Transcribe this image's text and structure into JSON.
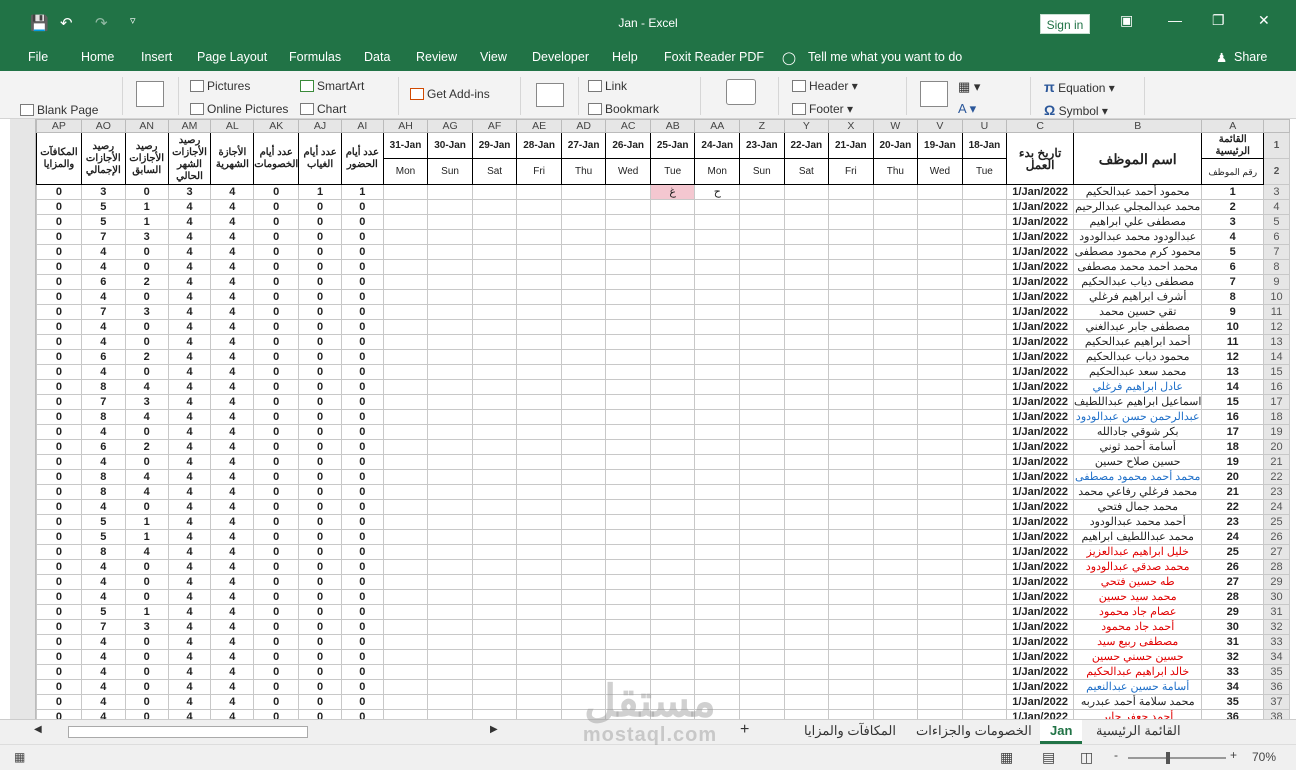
{
  "window": {
    "title": "Jan  -  Excel",
    "sign_in": "Sign in",
    "share": "Share"
  },
  "menu": [
    "File",
    "Home",
    "Insert",
    "Page Layout",
    "Formulas",
    "Data",
    "Review",
    "View",
    "Developer",
    "Help",
    "Foxit Reader PDF",
    "Tell me what you want to do"
  ],
  "ribbon": {
    "blank_page": "Blank Page",
    "pictures": "Pictures",
    "online_pictures": "Online Pictures",
    "smartart": "SmartArt",
    "chart": "Chart",
    "get_addins": "Get Add-ins",
    "link": "Link",
    "bookmark": "Bookmark",
    "header": "Header",
    "footer": "Footer",
    "equation": "Equation",
    "symbol": "Symbol"
  },
  "columns": [
    "AP",
    "AO",
    "AN",
    "AM",
    "AL",
    "AK",
    "AJ",
    "AI",
    "AH",
    "AG",
    "AF",
    "AE",
    "AD",
    "AC",
    "AB",
    "AA",
    "Z",
    "Y",
    "X",
    "W",
    "V",
    "U",
    "C",
    "B",
    "A"
  ],
  "headers": {
    "bonus": "المكافآت والمزايا",
    "total_leave_balance": "رصيد الأجازات الإجمالي",
    "prev_leave_balance": "رصيد الأجازات السابق",
    "monthly_leave_balance": "رصيد الأجازات الشهر الحالي",
    "monthly_leave": "الأجازة الشهرية",
    "deduction_days": "عدد أيام الخصومات",
    "absence_days": "عدد أيام الغياب",
    "attendance_days": "عدد أيام الحضور",
    "start_date": "تاريخ بدء العمل",
    "emp_name": "اسم الموظف",
    "main_list": "القائمة الرئيسية",
    "emp_no": "رقم الموظف"
  },
  "dates": [
    "31-Jan",
    "30-Jan",
    "29-Jan",
    "28-Jan",
    "27-Jan",
    "26-Jan",
    "25-Jan",
    "24-Jan",
    "23-Jan",
    "22-Jan",
    "21-Jan",
    "20-Jan",
    "19-Jan",
    "18-Jan"
  ],
  "days": [
    "Mon",
    "Sun",
    "Sat",
    "Fri",
    "Thu",
    "Wed",
    "Tue",
    "Mon",
    "Sun",
    "Sat",
    "Fri",
    "Thu",
    "Wed",
    "Tue"
  ],
  "marks": {
    "r1_25": "غ",
    "r1_24": "ح"
  },
  "rows": [
    {
      "n": "1",
      "name": "محمود أحمد عبدالحكيم",
      "c": "",
      "d": "1/Jan/2022",
      "v": [
        "0",
        "3",
        "0",
        "3",
        "4",
        "0",
        "1",
        "1"
      ]
    },
    {
      "n": "2",
      "name": "محمد عبدالمجلي عبدالرحيم",
      "c": "",
      "d": "1/Jan/2022",
      "v": [
        "0",
        "5",
        "1",
        "4",
        "4",
        "0",
        "0",
        "0"
      ]
    },
    {
      "n": "3",
      "name": "مصطفى علي ابراهيم",
      "c": "",
      "d": "1/Jan/2022",
      "v": [
        "0",
        "5",
        "1",
        "4",
        "4",
        "0",
        "0",
        "0"
      ]
    },
    {
      "n": "4",
      "name": "عبدالودود محمد عبدالودود",
      "c": "",
      "d": "1/Jan/2022",
      "v": [
        "0",
        "7",
        "3",
        "4",
        "4",
        "0",
        "0",
        "0"
      ]
    },
    {
      "n": "5",
      "name": "محمود كرم محمود مصطفى",
      "c": "",
      "d": "1/Jan/2022",
      "v": [
        "0",
        "4",
        "0",
        "4",
        "4",
        "0",
        "0",
        "0"
      ]
    },
    {
      "n": "6",
      "name": "محمد احمد محمد مصطفى",
      "c": "",
      "d": "1/Jan/2022",
      "v": [
        "0",
        "4",
        "0",
        "4",
        "4",
        "0",
        "0",
        "0"
      ]
    },
    {
      "n": "7",
      "name": "مصطفى دياب عبدالحكيم",
      "c": "",
      "d": "1/Jan/2022",
      "v": [
        "0",
        "6",
        "2",
        "4",
        "4",
        "0",
        "0",
        "0"
      ]
    },
    {
      "n": "8",
      "name": "أشرف ابراهيم فرغلي",
      "c": "",
      "d": "1/Jan/2022",
      "v": [
        "0",
        "4",
        "0",
        "4",
        "4",
        "0",
        "0",
        "0"
      ]
    },
    {
      "n": "9",
      "name": "تقي حسين محمد",
      "c": "",
      "d": "1/Jan/2022",
      "v": [
        "0",
        "7",
        "3",
        "4",
        "4",
        "0",
        "0",
        "0"
      ]
    },
    {
      "n": "10",
      "name": "مصطفى جابر عبدالغني",
      "c": "",
      "d": "1/Jan/2022",
      "v": [
        "0",
        "4",
        "0",
        "4",
        "4",
        "0",
        "0",
        "0"
      ]
    },
    {
      "n": "11",
      "name": "أحمد ابراهيم عبدالحكيم",
      "c": "",
      "d": "1/Jan/2022",
      "v": [
        "0",
        "4",
        "0",
        "4",
        "4",
        "0",
        "0",
        "0"
      ]
    },
    {
      "n": "12",
      "name": "محمود دياب عبدالحكيم",
      "c": "",
      "d": "1/Jan/2022",
      "v": [
        "0",
        "6",
        "2",
        "4",
        "4",
        "0",
        "0",
        "0"
      ]
    },
    {
      "n": "13",
      "name": "محمد سعد عبدالحكيم",
      "c": "",
      "d": "1/Jan/2022",
      "v": [
        "0",
        "4",
        "0",
        "4",
        "4",
        "0",
        "0",
        "0"
      ]
    },
    {
      "n": "14",
      "name": "عادل ابراهيم فرغلي",
      "c": "blue",
      "d": "1/Jan/2022",
      "v": [
        "0",
        "8",
        "4",
        "4",
        "4",
        "0",
        "0",
        "0"
      ]
    },
    {
      "n": "15",
      "name": "اسماعيل ابراهيم عبداللطيف",
      "c": "",
      "d": "1/Jan/2022",
      "v": [
        "0",
        "7",
        "3",
        "4",
        "4",
        "0",
        "0",
        "0"
      ]
    },
    {
      "n": "16",
      "name": "عبدالرحمن حسن عبدالودود",
      "c": "blue",
      "d": "1/Jan/2022",
      "v": [
        "0",
        "8",
        "4",
        "4",
        "4",
        "0",
        "0",
        "0"
      ]
    },
    {
      "n": "17",
      "name": "بكر شوقي جادالله",
      "c": "",
      "d": "1/Jan/2022",
      "v": [
        "0",
        "4",
        "0",
        "4",
        "4",
        "0",
        "0",
        "0"
      ]
    },
    {
      "n": "18",
      "name": "أسامة أحمد ثوني",
      "c": "",
      "d": "1/Jan/2022",
      "v": [
        "0",
        "6",
        "2",
        "4",
        "4",
        "0",
        "0",
        "0"
      ]
    },
    {
      "n": "19",
      "name": "حسين صلاح حسين",
      "c": "",
      "d": "1/Jan/2022",
      "v": [
        "0",
        "4",
        "0",
        "4",
        "4",
        "0",
        "0",
        "0"
      ]
    },
    {
      "n": "20",
      "name": "محمد أحمد محمود مصطفى",
      "c": "blue",
      "d": "1/Jan/2022",
      "v": [
        "0",
        "8",
        "4",
        "4",
        "4",
        "0",
        "0",
        "0"
      ]
    },
    {
      "n": "21",
      "name": "محمد فرغلي رفاعي محمد",
      "c": "",
      "d": "1/Jan/2022",
      "v": [
        "0",
        "8",
        "4",
        "4",
        "4",
        "0",
        "0",
        "0"
      ]
    },
    {
      "n": "22",
      "name": "محمد جمال فتحي",
      "c": "",
      "d": "1/Jan/2022",
      "v": [
        "0",
        "4",
        "0",
        "4",
        "4",
        "0",
        "0",
        "0"
      ]
    },
    {
      "n": "23",
      "name": "أحمد محمد عبدالودود",
      "c": "",
      "d": "1/Jan/2022",
      "v": [
        "0",
        "5",
        "1",
        "4",
        "4",
        "0",
        "0",
        "0"
      ]
    },
    {
      "n": "24",
      "name": "محمد عبداللطيف ابراهيم",
      "c": "",
      "d": "1/Jan/2022",
      "v": [
        "0",
        "5",
        "1",
        "4",
        "4",
        "0",
        "0",
        "0"
      ]
    },
    {
      "n": "25",
      "name": "خليل ابراهيم عبدالعزيز",
      "c": "red",
      "d": "1/Jan/2022",
      "v": [
        "0",
        "8",
        "4",
        "4",
        "4",
        "0",
        "0",
        "0"
      ]
    },
    {
      "n": "26",
      "name": "محمد صدقي عبدالودود",
      "c": "red",
      "d": "1/Jan/2022",
      "v": [
        "0",
        "4",
        "0",
        "4",
        "4",
        "0",
        "0",
        "0"
      ]
    },
    {
      "n": "27",
      "name": "طه حسين فتحي",
      "c": "red",
      "d": "1/Jan/2022",
      "v": [
        "0",
        "4",
        "0",
        "4",
        "4",
        "0",
        "0",
        "0"
      ]
    },
    {
      "n": "28",
      "name": "محمد سيد حسين",
      "c": "red",
      "d": "1/Jan/2022",
      "v": [
        "0",
        "4",
        "0",
        "4",
        "4",
        "0",
        "0",
        "0"
      ]
    },
    {
      "n": "29",
      "name": "عصام جاد محمود",
      "c": "red",
      "d": "1/Jan/2022",
      "v": [
        "0",
        "5",
        "1",
        "4",
        "4",
        "0",
        "0",
        "0"
      ]
    },
    {
      "n": "30",
      "name": "أحمد جاد محمود",
      "c": "red",
      "d": "1/Jan/2022",
      "v": [
        "0",
        "7",
        "3",
        "4",
        "4",
        "0",
        "0",
        "0"
      ]
    },
    {
      "n": "31",
      "name": "مصطفى ربيع سيد",
      "c": "red",
      "d": "1/Jan/2022",
      "v": [
        "0",
        "4",
        "0",
        "4",
        "4",
        "0",
        "0",
        "0"
      ]
    },
    {
      "n": "32",
      "name": "حسين حسني حسين",
      "c": "red",
      "d": "1/Jan/2022",
      "v": [
        "0",
        "4",
        "0",
        "4",
        "4",
        "0",
        "0",
        "0"
      ]
    },
    {
      "n": "33",
      "name": "خالد ابراهيم عبدالحكيم",
      "c": "red",
      "d": "1/Jan/2022",
      "v": [
        "0",
        "4",
        "0",
        "4",
        "4",
        "0",
        "0",
        "0"
      ]
    },
    {
      "n": "34",
      "name": "أسامة حسين عبدالنعيم",
      "c": "blue",
      "d": "1/Jan/2022",
      "v": [
        "0",
        "4",
        "0",
        "4",
        "4",
        "0",
        "0",
        "0"
      ]
    },
    {
      "n": "35",
      "name": "محمد سلامة أحمد عبدربه",
      "c": "",
      "d": "1/Jan/2022",
      "v": [
        "0",
        "4",
        "0",
        "4",
        "4",
        "0",
        "0",
        "0"
      ]
    },
    {
      "n": "36",
      "name": "أحمد جعفر جابر",
      "c": "red",
      "d": "1/Jan/2022",
      "v": [
        "0",
        "4",
        "0",
        "4",
        "4",
        "0",
        "0",
        "0"
      ]
    }
  ],
  "row_numbers": [
    "1",
    "2",
    "3",
    "4",
    "5",
    "6",
    "7",
    "8",
    "9",
    "10",
    "11",
    "12",
    "13",
    "14",
    "15",
    "16",
    "17",
    "18",
    "19",
    "20",
    "21",
    "22",
    "23",
    "24",
    "25",
    "26",
    "27",
    "28",
    "29",
    "30",
    "31",
    "32",
    "33",
    "34",
    "35",
    "36",
    "37",
    "38"
  ],
  "tabs": {
    "main": "القائمة الرئيسية",
    "jan": "Jan",
    "deductions": "الخصومات والجزاءات",
    "bonus": "المكافآت والمزايا",
    "add": "+"
  },
  "status": {
    "zoom": "70%",
    "zoom_minus": "-",
    "zoom_plus": "+"
  },
  "watermark": {
    "ar": "مستقل",
    "en": "mostaql.com"
  }
}
